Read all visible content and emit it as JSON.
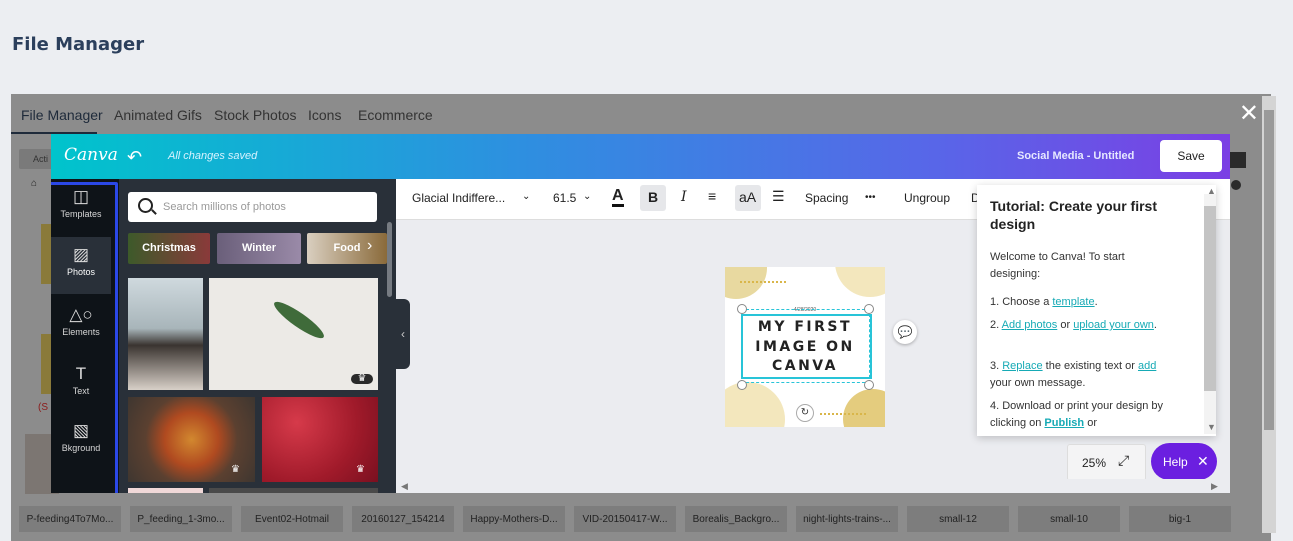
{
  "page": {
    "title": "File Manager"
  },
  "file_manager": {
    "tabs": [
      "File Manager",
      "Animated Gifs",
      "Stock Photos",
      "Icons",
      "Ecommerce"
    ],
    "active_tab": "File Manager",
    "close_label": "✕",
    "thumbnails": [
      "P-feeding4To7Mo...",
      "P_feeding_1-3mo...",
      "Event02-Hotmail",
      "20160127_154214",
      "Happy-Mothers-D...",
      "VID-20150417-W...",
      "Borealis_Backgro...",
      "night-lights-trains-...",
      "small-12",
      "small-10",
      "big-1"
    ],
    "hidden_fragments": {
      "action": "Acti",
      "marker": "(S"
    }
  },
  "canva": {
    "logo": "Canva",
    "save_status": "All changes saved",
    "design_title": "Social Media - Untitled",
    "save_label": "Save",
    "sidebar": [
      {
        "label": "Templates",
        "icon": "templates-icon"
      },
      {
        "label": "Photos",
        "icon": "photos-icon"
      },
      {
        "label": "Elements",
        "icon": "elements-icon"
      },
      {
        "label": "Text",
        "icon": "text-icon"
      },
      {
        "label": "Bkground",
        "icon": "background-icon"
      }
    ],
    "active_sidebar": "Photos",
    "search_placeholder": "Search millions of photos",
    "categories": [
      "Christmas",
      "Winter",
      "Food"
    ],
    "toolbar": {
      "font": "Glacial Indiffere...",
      "font_size": "61.5",
      "spacing": "Spacing",
      "more": "•••",
      "ungroup": "Ungroup",
      "truncated": "D"
    },
    "design": {
      "date": "4/28/2020",
      "text": "MY FIRST IMAGE ON CANVA"
    },
    "tutorial": {
      "title": "Tutorial: Create your first design",
      "intro": "Welcome to Canva! To start designing:",
      "step1_pre": "1. Choose a ",
      "step1_link": "template",
      "step1_post": ".",
      "step2_pre": "2. ",
      "step2_link1": "Add photos",
      "step2_mid": " or ",
      "step2_link2": "upload your own",
      "step2_post": ".",
      "step3_pre": "3. ",
      "step3_link1": "Replace",
      "step3_mid": " the existing text or ",
      "step3_link2": "add",
      "step3_post": " your own message.",
      "step4_pre": "4. Download or print your design by clicking on ",
      "step4_link": "Publish",
      "step4_post": " or"
    },
    "zoom": "25%",
    "help_label": "Help",
    "colors": {
      "accent": "#00c4cc",
      "purple": "#7b3fe4",
      "help": "#6b1fe0",
      "selection": "#28c4d8"
    }
  }
}
